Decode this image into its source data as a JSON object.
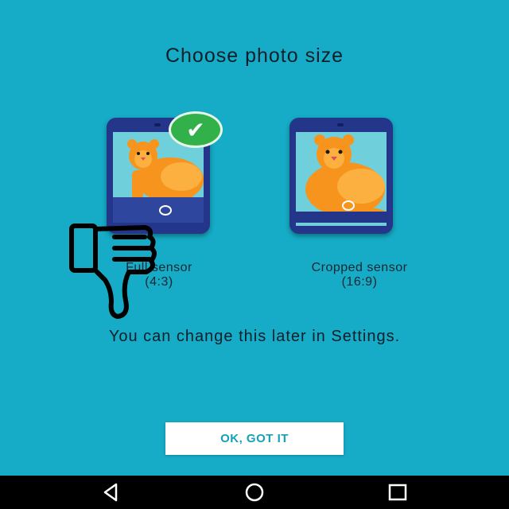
{
  "title": "Choose photo size",
  "options": [
    {
      "label": "Full sensor",
      "sublabel": "(4:3)",
      "selected": true
    },
    {
      "label": "Cropped sensor",
      "sublabel": "(16:9)",
      "selected": false
    }
  ],
  "info": "You can change this later in Settings.",
  "ok_button": "OK, GOT IT",
  "check_icon": "✔",
  "colors": {
    "background": "#16abc6",
    "phone": "#23368a",
    "check": "#32b14a",
    "button_text": "#16a0b8"
  },
  "icons": [
    "checkmark-icon",
    "thumbs-down-icon",
    "back-icon",
    "home-icon",
    "recents-icon"
  ]
}
